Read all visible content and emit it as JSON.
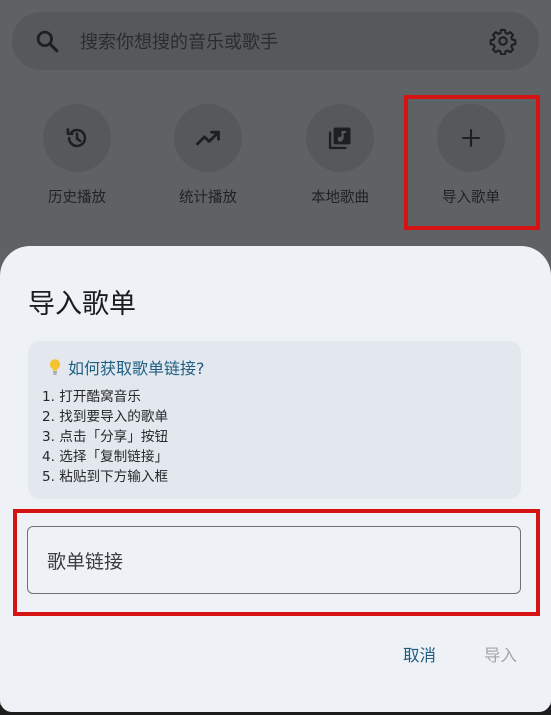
{
  "search": {
    "placeholder": "搜索你想搜的音乐或歌手"
  },
  "quick_actions": [
    {
      "label": "历史播放",
      "icon": "history-icon"
    },
    {
      "label": "统计播放",
      "icon": "trending-up-icon"
    },
    {
      "label": "本地歌曲",
      "icon": "music-library-icon"
    },
    {
      "label": "导入歌单",
      "icon": "add-icon"
    }
  ],
  "dialog": {
    "title": "导入歌单",
    "help": {
      "icon": "lightbulb-icon",
      "title": "如何获取歌单链接?",
      "steps": [
        "1. 打开酷窝音乐",
        "2. 找到要导入的歌单",
        "3. 点击「分享」按钮",
        "4. 选择「复制链接」",
        "5. 粘贴到下方输入框"
      ]
    },
    "input": {
      "placeholder": "歌单链接",
      "value": ""
    },
    "cancel_label": "取消",
    "import_label": "导入"
  },
  "colors": {
    "accent": "#1f5e82",
    "highlight": "#d61313",
    "disabled": "#a1a5aa"
  }
}
